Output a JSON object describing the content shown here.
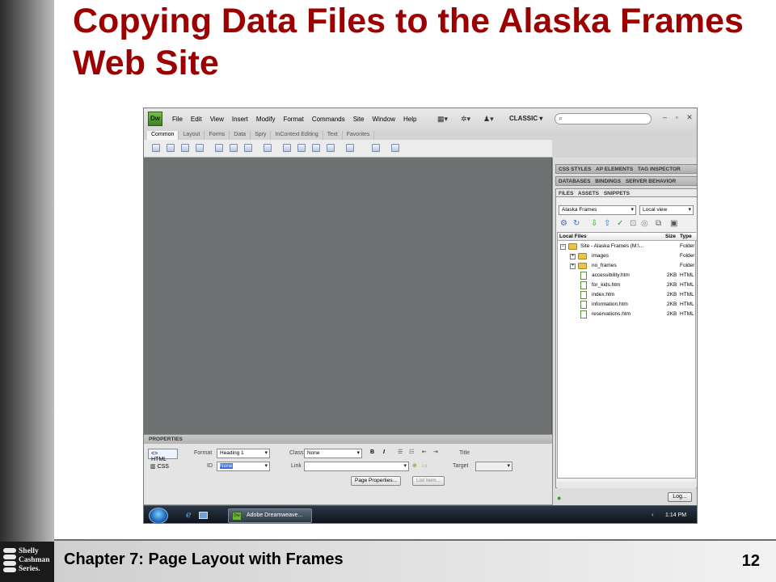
{
  "slide": {
    "title": "Copying Data Files to the Alaska Frames Web Site",
    "footer": "Chapter 7: Page Layout with Frames",
    "page_number": "12",
    "logo_lines": [
      "Shelly",
      "Cashman",
      "Series."
    ]
  },
  "app": {
    "logo": "Dw",
    "menu": [
      "File",
      "Edit",
      "View",
      "Insert",
      "Modify",
      "Format",
      "Commands",
      "Site",
      "Window",
      "Help"
    ],
    "workspace": "CLASSIC",
    "window_controls": "– ▫ ✕",
    "insert_tabs": [
      "Common",
      "Layout",
      "Forms",
      "Data",
      "Spry",
      "InContext Editing",
      "Text",
      "Favorites"
    ],
    "panel_groups": [
      [
        "CSS STYLES",
        "AP ELEMENTS",
        "TAG INSPECTOR"
      ],
      [
        "DATABASES",
        "BINDINGS",
        "SERVER BEHAVIOR"
      ],
      [
        "FILES",
        "ASSETS",
        "SNIPPETS"
      ]
    ],
    "files": {
      "site": "Alaska Frames",
      "view": "Local view",
      "columns": [
        "Local Files",
        "Size",
        "Type"
      ],
      "rows": [
        {
          "name": "Site - Alaska Frames (M:\\...",
          "size": "",
          "type": "Folder"
        },
        {
          "name": "images",
          "size": "",
          "type": "Folder"
        },
        {
          "name": "no_frames",
          "size": "",
          "type": "Folder"
        },
        {
          "name": "accessibility.htm",
          "size": "2KB",
          "type": "HTML"
        },
        {
          "name": "for_kids.htm",
          "size": "2KB",
          "type": "HTML"
        },
        {
          "name": "index.htm",
          "size": "2KB",
          "type": "HTML"
        },
        {
          "name": "information.htm",
          "size": "2KB",
          "type": "HTML"
        },
        {
          "name": "reservations.htm",
          "size": "2KB",
          "type": "HTML"
        }
      ],
      "log_button": "Log..."
    },
    "properties": {
      "header": "PROPERTIES",
      "html_btn": "HTML",
      "css_btn": "CSS",
      "format_label": "Format",
      "format_value": "Heading 1",
      "class_label": "Class",
      "class_value": "None",
      "id_label": "ID",
      "id_value": "None",
      "link_label": "Link",
      "title_label": "Title",
      "target_label": "Target",
      "bold": "B",
      "italic": "I",
      "page_props_btn": "Page Properties...",
      "list_item_btn": "List Item..."
    },
    "taskbar": {
      "task": "Adobe Dreamweave...",
      "task_icon": "Dw",
      "clock": "1:14 PM"
    }
  }
}
